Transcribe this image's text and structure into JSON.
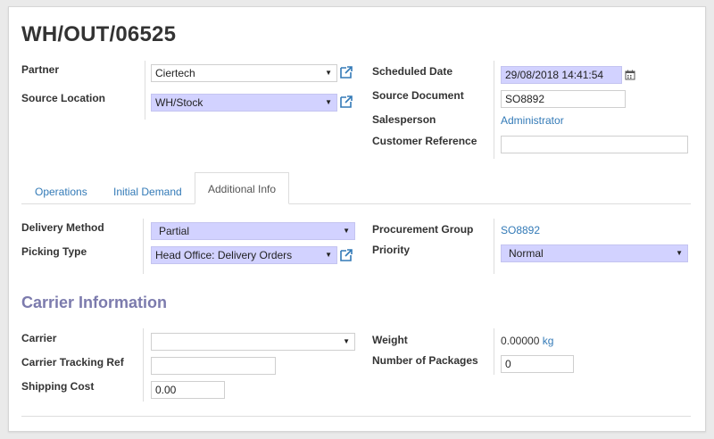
{
  "record": {
    "title": "WH/OUT/06525"
  },
  "header_left": {
    "partner": {
      "label": "Partner",
      "value": "Ciertech"
    },
    "source_location": {
      "label": "Source Location",
      "value": "WH/Stock"
    }
  },
  "header_right": {
    "scheduled_date": {
      "label": "Scheduled Date",
      "value": "29/08/2018 14:41:54"
    },
    "source_document": {
      "label": "Source Document",
      "value": "SO8892"
    },
    "salesperson": {
      "label": "Salesperson",
      "value": "Administrator"
    },
    "customer_reference": {
      "label": "Customer Reference",
      "value": ""
    }
  },
  "tabs": [
    {
      "label": "Operations",
      "active": false
    },
    {
      "label": "Initial Demand",
      "active": false
    },
    {
      "label": "Additional Info",
      "active": true
    }
  ],
  "additional_info": {
    "delivery_method": {
      "label": "Delivery Method",
      "value": "Partial"
    },
    "picking_type": {
      "label": "Picking Type",
      "value": "Head Office: Delivery Orders"
    },
    "procurement_group": {
      "label": "Procurement Group",
      "value": "SO8892"
    },
    "priority": {
      "label": "Priority",
      "value": "Normal"
    }
  },
  "carrier_info": {
    "section_title": "Carrier Information",
    "carrier": {
      "label": "Carrier",
      "value": ""
    },
    "tracking_ref": {
      "label": "Carrier Tracking Ref",
      "value": ""
    },
    "shipping_cost": {
      "label": "Shipping Cost",
      "value": "0.00"
    },
    "weight": {
      "label": "Weight",
      "value": "0.00000",
      "unit": "kg"
    },
    "packages": {
      "label": "Number of Packages",
      "value": "0"
    }
  },
  "colors": {
    "required_field": "#d2d2ff",
    "link": "#337ab7",
    "section_title": "#7c7bad"
  },
  "icons": {
    "external_link": "external-link-icon",
    "calendar": "calendar-icon",
    "dropdown": "caret-down-icon"
  }
}
